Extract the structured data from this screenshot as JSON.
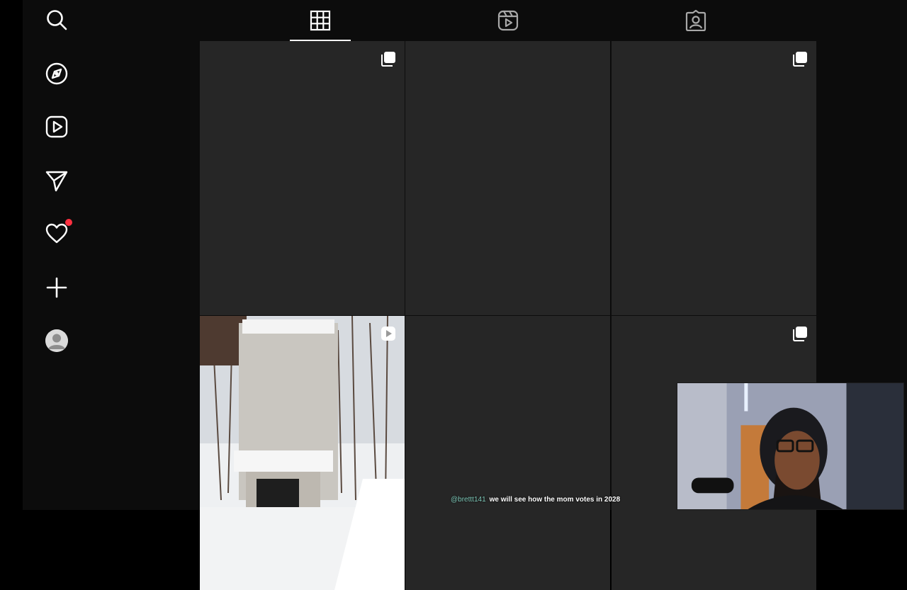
{
  "sidebar": {
    "items": [
      {
        "name": "search",
        "icon": "search-icon"
      },
      {
        "name": "explore",
        "icon": "compass-icon"
      },
      {
        "name": "reels",
        "icon": "reels-icon"
      },
      {
        "name": "messages",
        "icon": "send-icon"
      },
      {
        "name": "notifications",
        "icon": "heart-icon",
        "has_badge": true
      },
      {
        "name": "create",
        "icon": "plus-icon"
      },
      {
        "name": "profile",
        "icon": "avatar-icon"
      }
    ]
  },
  "tabs": [
    {
      "name": "posts",
      "icon": "grid-icon",
      "active": true
    },
    {
      "name": "reels",
      "icon": "reels-icon",
      "active": false
    },
    {
      "name": "tagged",
      "icon": "tagged-icon",
      "active": false
    }
  ],
  "grid": {
    "cells": [
      {
        "badge": "carousel-icon",
        "has_image": false
      },
      {
        "badge": "",
        "has_image": false
      },
      {
        "badge": "carousel-icon",
        "has_image": false
      },
      {
        "badge": "reel-play-icon",
        "has_image": true
      },
      {
        "badge": "",
        "has_image": false
      },
      {
        "badge": "carousel-icon",
        "has_image": false
      }
    ]
  },
  "chat_overlay": {
    "username": "@brettt141",
    "message": "we will see how the mom votes in 2028"
  },
  "colors": {
    "background": "#0c0c0c",
    "cell": "#262626",
    "notification_dot": "#ff3040",
    "username": "#7ec8b8"
  }
}
